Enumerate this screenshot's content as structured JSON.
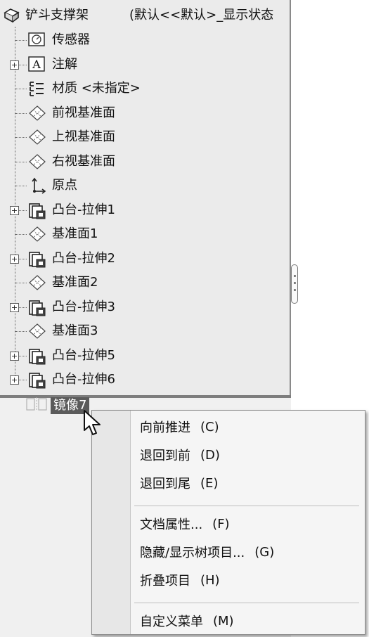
{
  "tree": {
    "root": {
      "label": "铲斗支撑架",
      "config": "(默认<<默认>_显示状态"
    },
    "items": [
      {
        "label": "传感器",
        "icon": "sensor-icon",
        "expandable": false
      },
      {
        "label": "注解",
        "icon": "annotation-icon",
        "expandable": true
      },
      {
        "label": "材质 <未指定>",
        "icon": "material-icon",
        "expandable": false
      },
      {
        "label": "前视基准面",
        "icon": "plane-icon",
        "expandable": false
      },
      {
        "label": "上视基准面",
        "icon": "plane-icon",
        "expandable": false
      },
      {
        "label": "右视基准面",
        "icon": "plane-icon",
        "expandable": false
      },
      {
        "label": "原点",
        "icon": "origin-icon",
        "expandable": false
      },
      {
        "label": "凸台-拉伸1",
        "icon": "extrude-icon",
        "expandable": true
      },
      {
        "label": "基准面1",
        "icon": "plane-icon",
        "expandable": false
      },
      {
        "label": "凸台-拉伸2",
        "icon": "extrude-icon",
        "expandable": true
      },
      {
        "label": "基准面2",
        "icon": "plane-icon",
        "expandable": false
      },
      {
        "label": "凸台-拉伸3",
        "icon": "extrude-icon",
        "expandable": true
      },
      {
        "label": "基准面3",
        "icon": "plane-icon",
        "expandable": false
      },
      {
        "label": "凸台-拉伸5",
        "icon": "extrude-icon",
        "expandable": true
      },
      {
        "label": "凸台-拉伸6",
        "icon": "extrude-icon",
        "expandable": true
      }
    ],
    "selected_item": {
      "label": "镜像7",
      "icon": "mirror-icon"
    }
  },
  "context_menu": {
    "groups": [
      [
        {
          "label": "向前推进",
          "shortcut": "(C)"
        },
        {
          "label": "退回到前",
          "shortcut": "(D)"
        },
        {
          "label": "退回到尾",
          "shortcut": "(E)"
        }
      ],
      [
        {
          "label": "文档属性...",
          "shortcut": "(F)"
        },
        {
          "label": "隐藏/显示树项目...",
          "shortcut": "(G)"
        },
        {
          "label": "折叠项目",
          "shortcut": "(H)"
        }
      ],
      [
        {
          "label": "自定义菜单",
          "shortcut": "(M)"
        }
      ]
    ]
  },
  "colors": {
    "panel_bg": "#ebebeb",
    "selection_bg": "#5b5b5b",
    "menu_bg": "#f5f5f5"
  }
}
